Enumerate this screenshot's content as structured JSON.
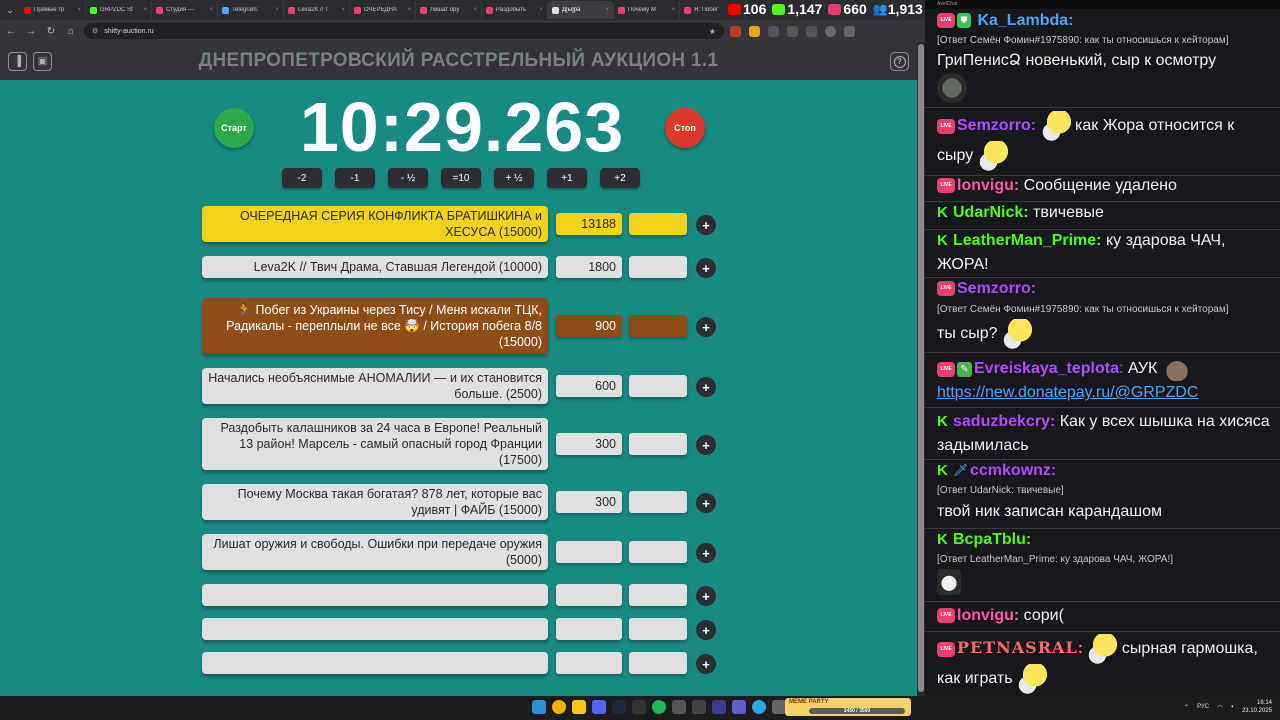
{
  "browser": {
    "tabs": [
      {
        "label": "Прямые тр",
        "color": "#ff0000"
      },
      {
        "label": "GRPZDC St",
        "color": "#53fc18"
      },
      {
        "label": "Студия — ",
        "color": "#e83e70"
      },
      {
        "label": "Telegram: ",
        "color": "#4ea4ff"
      },
      {
        "label": "Leva2K // Т",
        "color": "#e83e70"
      },
      {
        "label": "ОЧЕРЕДНА",
        "color": "#e83e70"
      },
      {
        "label": "Лишат ору",
        "color": "#e83e70"
      },
      {
        "label": "Раздобыть",
        "color": "#e83e70"
      },
      {
        "label": "Д[ы]ра",
        "color": "#dddddd"
      },
      {
        "label": "Почему М",
        "color": "#e83e70"
      },
      {
        "label": "Я: Побег",
        "color": "#e83e70"
      }
    ],
    "active_tab_index": 8,
    "url": "shitty-auction.ru"
  },
  "stream_stats": [
    {
      "value": "106",
      "color": "#ff0000"
    },
    {
      "value": "1,147",
      "color": "#53fc18"
    },
    {
      "value": "660",
      "color": "#e83e70"
    },
    {
      "value": "1,913",
      "color": "#4ea4ff"
    }
  ],
  "auction": {
    "title": "ДНЕПРОПЕТРОВСКИЙ РАССТРЕЛЬНЫЙ АУКЦИОН 1.1",
    "timer": "10:29.263",
    "start_label": "Старт",
    "stop_label": "Стоп",
    "help_label": "?",
    "adjust": [
      "-2",
      "-1",
      "- ½",
      "=10",
      "+ ½",
      "+1",
      "+2"
    ],
    "lots": [
      {
        "name": "ОЧЕРЕДНАЯ СЕРИЯ КОНФЛИКТА БРАТИШКИНА и ХЕСУСА (15000)",
        "amount": "13188"
      },
      {
        "name": "Leva2K // Твич Драма, Ставшая Легендой (10000)",
        "amount": "1800"
      },
      {
        "name": "🏃 Побег из Украины через Тису / Меня искали ТЦК, Радикалы - переплыли не все 🤯 / История побега 8/8 (15000)",
        "amount": "900"
      },
      {
        "name": "Начались необъяснимые АНОМАЛИИ — и их становится больше. (2500)",
        "amount": "600"
      },
      {
        "name": "Раздобыть калашников за 24 часа в Европе! Реальный 13 район! Марсель - самый опасный город Франции (17500)",
        "amount": "300"
      },
      {
        "name": "Почему Москва такая богатая? 878 лет, которые вас удивят | ФАЙБ (15000)",
        "amount": "300"
      },
      {
        "name": "Лишат оружия и свободы. Ошибки при передаче оружия (5000)",
        "amount": ""
      },
      {
        "name": "",
        "amount": ""
      },
      {
        "name": "",
        "amount": ""
      },
      {
        "name": "",
        "amount": ""
      }
    ]
  },
  "chat": {
    "app_title": "AxelChat",
    "messages": [
      {
        "nick": "Ka_Lambda",
        "reply": "",
        "text": ""
      },
      {
        "nick": "",
        "reply": "[Ответ Семён Фомин#1975890: как ты относишься к хейторам]",
        "text": "ГриПенисՁ новенький, сыр к осмотру"
      },
      {
        "nick": "Semzorro",
        "reply": "",
        "text": "как Жора относится к сыру"
      },
      {
        "nick": "lonvigu",
        "reply": "",
        "text": "Сообщение удалено"
      },
      {
        "nick": "UdarNick",
        "reply": "",
        "text": "твичевые"
      },
      {
        "nick": "LeatherMan_Prime",
        "reply": "",
        "text": "ку здарова ЧАЧ, ЖОРА!"
      },
      {
        "nick": "Semzorro",
        "reply": "[Ответ Семён Фомин#1975890: как ты относишься к хейторам]",
        "text": "ты сыр?"
      },
      {
        "nick": "Evreiskaya_teplota",
        "reply": "",
        "text": "АУК",
        "link": "https://new.donatepay.ru/@GRPZDC"
      },
      {
        "nick": "saduzbekcry",
        "reply": "",
        "text": "Как у всех шышка на хисяса задымилась"
      },
      {
        "nick": "ccmkownz",
        "reply": "[Ответ UdarNick: твичевые]",
        "text": "твой ник записан карандашом"
      },
      {
        "nick": "BcpaTblu",
        "reply": "[Ответ LeatherMan_Prime: ку здарова ЧАЧ, ЖОРА!]",
        "text": ""
      },
      {
        "nick": "lonvigu",
        "reply": "",
        "text": "сори("
      },
      {
        "nick": "PETNASRAL",
        "reply": "",
        "text": "сырная гармошка, как играть"
      }
    ],
    "colors": {
      "ka_lambda": "#4ea4ff",
      "semzorro": "#b04cff",
      "lonvigu": "#ff5aa5",
      "kick_green": "#53fc18",
      "evreiskaya": "#b04cff",
      "saduzbekcry": "#b04cff",
      "ccmkownz": "#b04cff",
      "petnasral": "#ff6a6a"
    }
  },
  "taskbar": {
    "widget_title": "MEME PARTY",
    "widget_progress": "1450 / 3500",
    "lang": "РУС",
    "time": "16:14",
    "date": "23.10.2025"
  }
}
